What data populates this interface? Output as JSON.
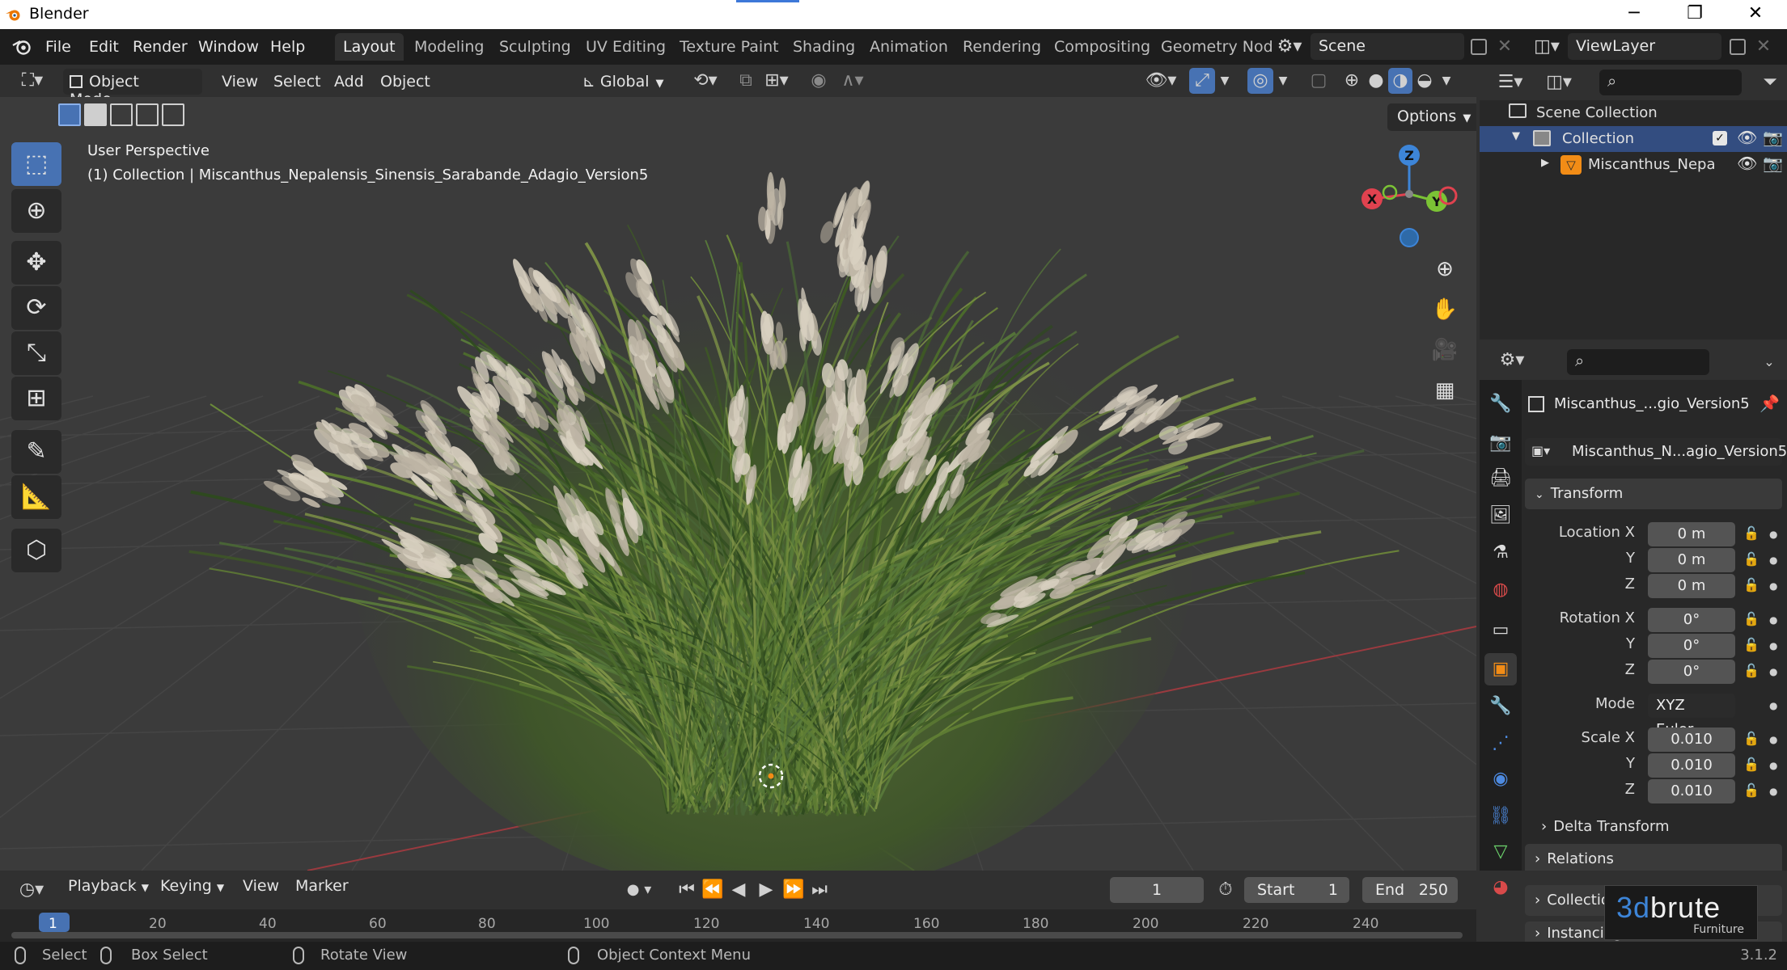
{
  "titlebar": {
    "app_title": "Blender",
    "minimize": "─",
    "maximize": "❐",
    "close": "✕"
  },
  "menu": {
    "file": "File",
    "edit": "Edit",
    "render": "Render",
    "window": "Window",
    "help": "Help"
  },
  "workspaces": [
    "Layout",
    "Modeling",
    "Sculpting",
    "UV Editing",
    "Texture Paint",
    "Shading",
    "Animation",
    "Rendering",
    "Compositing",
    "Geometry Nod"
  ],
  "scene": {
    "name": "Scene"
  },
  "viewlayer": {
    "name": "ViewLayer"
  },
  "viewport_header": {
    "mode": "Object Mode",
    "view": "View",
    "select": "Select",
    "add": "Add",
    "object": "Object",
    "orientation": "Global"
  },
  "viewport": {
    "info_line1": "User Perspective",
    "info_line2": "(1) Collection | Miscanthus_Nepalensis_Sinensis_Sarabande_Adagio_Version5",
    "options": "Options",
    "gizmo": {
      "x": "X",
      "y": "Y",
      "z": "Z"
    }
  },
  "outliner": {
    "scene_collection": "Scene Collection",
    "collection": "Collection",
    "object": "Miscanthus_Nepa"
  },
  "properties": {
    "object_name": "Miscanthus_...gio_Version5",
    "data_name": "Miscanthus_N...agio_Version5",
    "transform": {
      "title": "Transform",
      "location_label": "Location X",
      "rotation_label": "Rotation X",
      "scale_label": "Scale X",
      "y": "Y",
      "z": "Z",
      "mode_label": "Mode",
      "mode_value": "XYZ Euler",
      "location": [
        "0 m",
        "0 m",
        "0 m"
      ],
      "rotation": [
        "0°",
        "0°",
        "0°"
      ],
      "scale": [
        "0.010",
        "0.010",
        "0.010"
      ]
    },
    "delta_transform": "Delta Transform",
    "relations": "Relations",
    "collections": "Collections",
    "instancing": "Instancing"
  },
  "timeline": {
    "playback": "Playback",
    "keying": "Keying",
    "view": "View",
    "marker": "Marker",
    "current_frame": "1",
    "start_label": "Start",
    "start": "1",
    "end_label": "End",
    "end": "250",
    "ticks": [
      "1",
      "20",
      "40",
      "60",
      "80",
      "100",
      "120",
      "140",
      "160",
      "180",
      "200",
      "220",
      "240"
    ]
  },
  "statusbar": {
    "select": "Select",
    "box_select": "Box Select",
    "rotate_view": "Rotate View",
    "context_menu": "Object Context Menu",
    "version": "3.1.2"
  },
  "watermark": {
    "brand_prefix": "3d",
    "brand_suffix": "brute",
    "tagline": "Furniture"
  },
  "colors": {
    "accent": "#4772b3",
    "x_axis": "#e0424f",
    "y_axis": "#7bc335",
    "z_axis": "#3d85d8",
    "origin": "#f28c16"
  }
}
